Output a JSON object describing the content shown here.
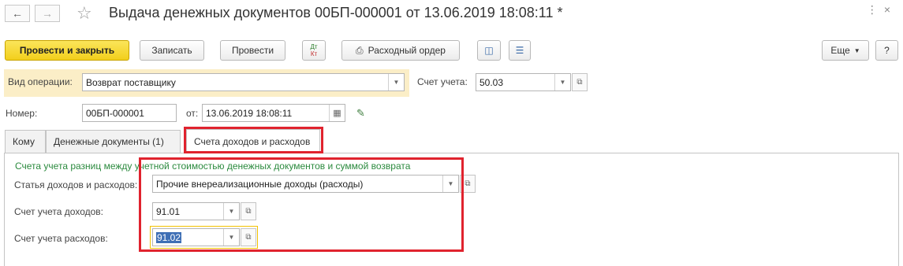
{
  "title": "Выдача денежных документов 00БП-000001 от 13.06.2019 18:08:11 *",
  "toolbar": {
    "post_close": "Провести и закрыть",
    "save": "Записать",
    "post": "Провести",
    "dtkt": "Дт Кт",
    "cash_order": "Расходный ордер",
    "more": "Еще",
    "help": "?"
  },
  "form": {
    "op_type_label": "Вид операции:",
    "op_type_value": "Возврат поставщику",
    "account_label": "Счет учета:",
    "account_value": "50.03",
    "number_label": "Номер:",
    "number_value": "00БП-000001",
    "date_label": "от:",
    "date_value": "13.06.2019 18:08:11"
  },
  "tabs": [
    {
      "label": "Кому"
    },
    {
      "label": "Денежные документы (1)"
    },
    {
      "label": "Счета доходов и расходов"
    }
  ],
  "panel": {
    "heading": "Счета учета разниц между учетной стоимостью денежных документов и суммой возврата",
    "item_label": "Статья доходов и расходов:",
    "item_value": "Прочие внереализационные доходы (расходы)",
    "income_label": "Счет учета доходов:",
    "income_value": "91.01",
    "expense_label": "Счет учета расходов:",
    "expense_value": "91.02"
  },
  "colors": {
    "primary_button": "#f6d72c",
    "highlight_box": "#e0232e",
    "heading_green": "#2b8a3e",
    "operation_band": "#fbeec7"
  }
}
